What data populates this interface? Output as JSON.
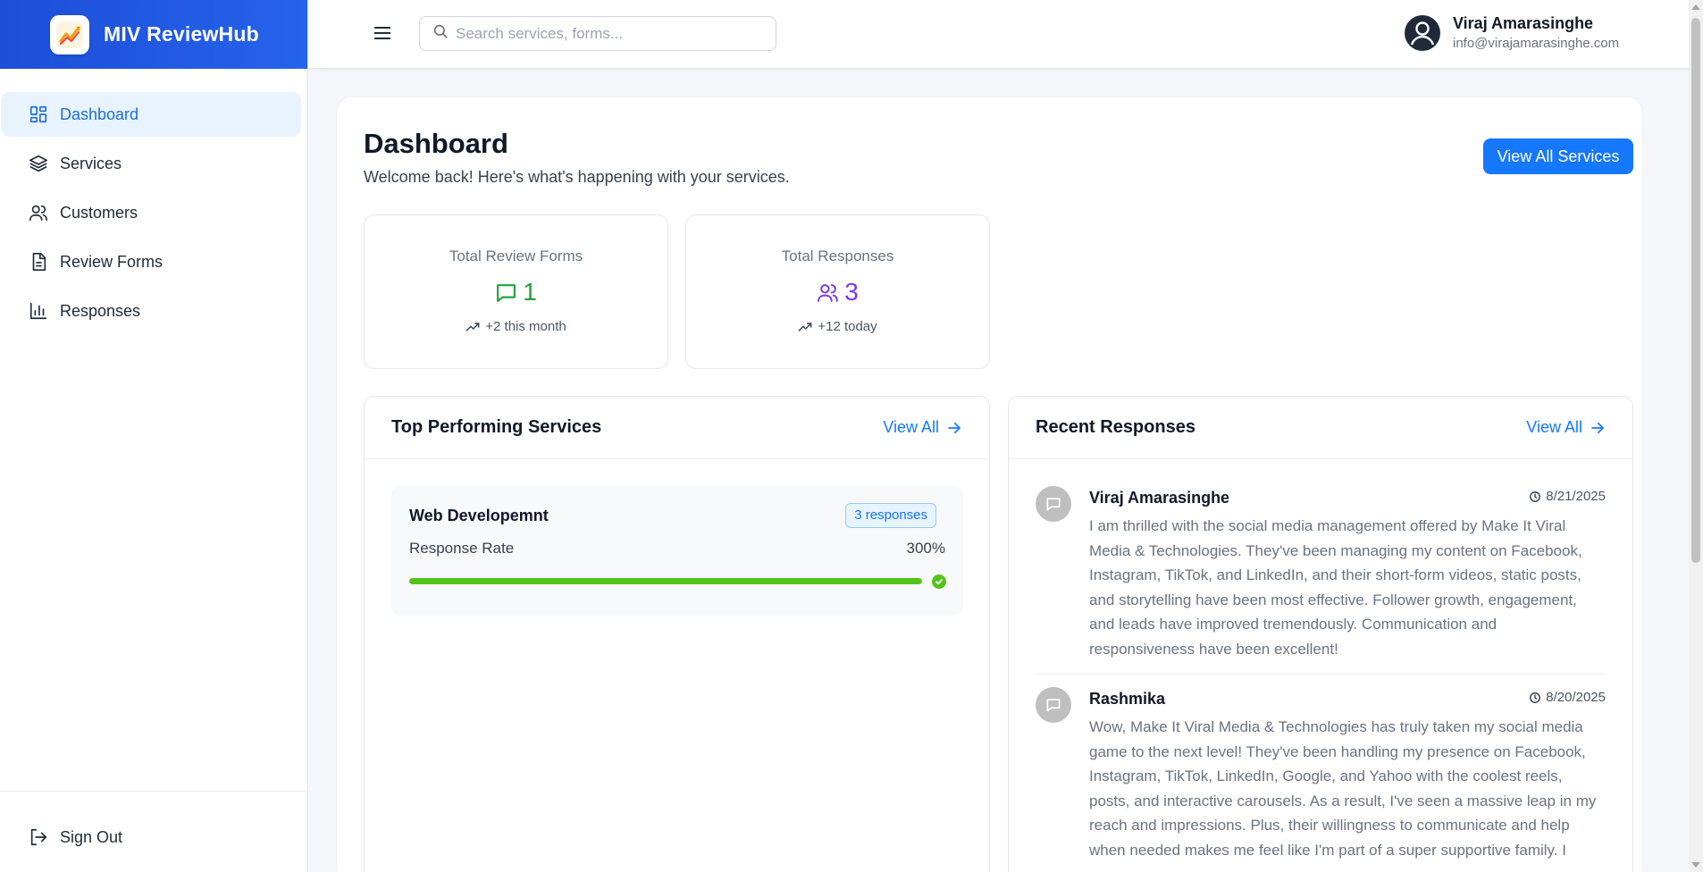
{
  "brand": {
    "name": "MIV ReviewHub"
  },
  "sidebar": {
    "items": [
      {
        "label": "Dashboard",
        "icon": "dashboard-icon",
        "active": true
      },
      {
        "label": "Services",
        "icon": "layers-icon"
      },
      {
        "label": "Customers",
        "icon": "users-icon"
      },
      {
        "label": "Review Forms",
        "icon": "file-text-icon"
      },
      {
        "label": "Responses",
        "icon": "bar-chart-icon"
      }
    ],
    "sign_out": "Sign Out"
  },
  "header": {
    "search_placeholder": "Search services, forms...",
    "user": {
      "name": "Viraj Amarasinghe",
      "email": "info@virajamarasinghe.com"
    }
  },
  "dashboard": {
    "title": "Dashboard",
    "subtitle": "Welcome back! Here's what's happening with your services.",
    "view_all_services": "View All Services",
    "stats": [
      {
        "label": "Total Review Forms",
        "value": "1",
        "trend": "+2 this month",
        "color": "#22a03a"
      },
      {
        "label": "Total Responses",
        "value": "3",
        "trend": "+12 today",
        "color": "#7c3aed"
      }
    ],
    "top_services": {
      "title": "Top Performing Services",
      "view_all": "View All",
      "items": [
        {
          "name": "Web Developemnt",
          "badge": "3 responses",
          "rate_label": "Response Rate",
          "rate_value": "300%",
          "progress_percent": 100
        }
      ]
    },
    "recent_responses": {
      "title": "Recent Responses",
      "view_all": "View All",
      "items": [
        {
          "name": "Viraj Amarasinghe",
          "date": "8/21/2025",
          "text": "I am thrilled with the social media management offered by Make It Viral Media & Technologies. They've been managing my content on Facebook, Instagram, TikTok, and LinkedIn, and their short-form videos, static posts, and storytelling have been most effective. Follower growth, engagement, and leads have improved tremendously. Communication and responsiveness have been excellent!"
        },
        {
          "name": "Rashmika",
          "date": "8/20/2025",
          "text": "Wow, Make It Viral Media & Technologies has truly taken my social media game to the next level! They've been handling my presence on Facebook, Instagram, TikTok, LinkedIn, Google, and Yahoo with the coolest reels, posts, and interactive carousels. As a result, I've seen a massive leap in my reach and impressions. Plus, their willingness to communicate and help when needed makes me feel like I'm part of a super supportive family. I"
        }
      ]
    }
  },
  "colors": {
    "accent": "#1677ff",
    "brand": "#1d4ed8",
    "success": "#52c41a"
  }
}
